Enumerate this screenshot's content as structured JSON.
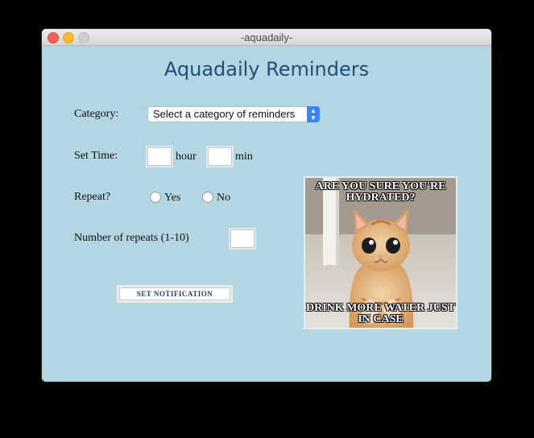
{
  "window": {
    "title": "-aquadaily-"
  },
  "heading": "Aquadaily Reminders",
  "category": {
    "label": "Category:",
    "selected": "Select a category of reminders"
  },
  "time": {
    "label": "Set Time:",
    "hour_unit": "hour",
    "min_unit": "min",
    "hour_value": "",
    "min_value": ""
  },
  "repeat": {
    "label": "Repeat?",
    "yes": "Yes",
    "no": "No"
  },
  "repeats_count": {
    "label": "Number of repeats (1-10)",
    "value": ""
  },
  "button": {
    "label": "SET NOTIFICATION"
  },
  "meme": {
    "top_text": "ARE YOU SURE YOU'RE HYDRATED?",
    "bottom_text": "DRINK MORE WATER JUST IN CASE"
  },
  "colors": {
    "background": "#b3d6e3",
    "heading": "#1e4e7a",
    "select_accent": "#3b82f6"
  }
}
